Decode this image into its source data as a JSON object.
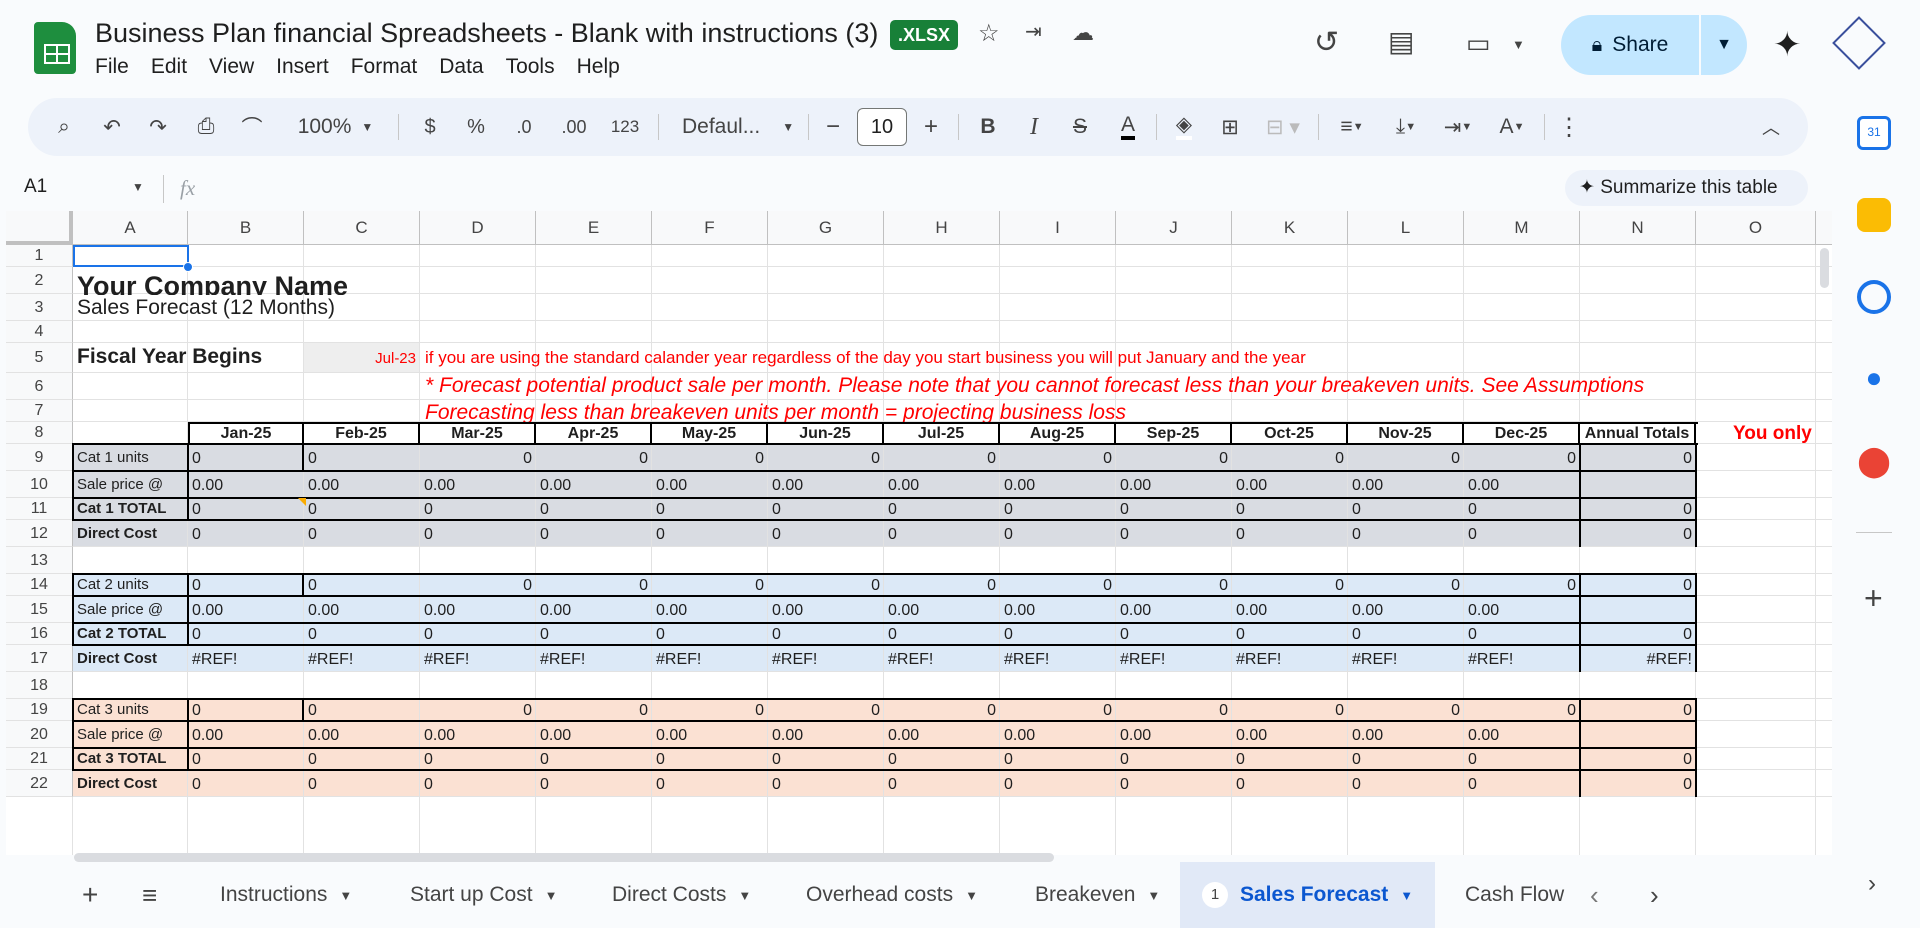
{
  "doc": {
    "title": "Business Plan financial Spreadsheets - Blank with instructions (3)",
    "badge": ".XLSX"
  },
  "menu": [
    "File",
    "Edit",
    "View",
    "Insert",
    "Format",
    "Data",
    "Tools",
    "Help"
  ],
  "share": {
    "label": "Share"
  },
  "toolbar": {
    "zoom": "100%",
    "currency": "$",
    "percent": "%",
    "dec_less": ".0",
    "dec_more": ".00",
    "format123": "123",
    "font": "Defaul...",
    "font_size": "10"
  },
  "formula": {
    "namebox": "A1",
    "fx": "fx",
    "summarize": "Summarize this table"
  },
  "columns": [
    "A",
    "B",
    "C",
    "D",
    "E",
    "F",
    "G",
    "H",
    "I",
    "J",
    "K",
    "L",
    "M",
    "N",
    "O"
  ],
  "rows": [
    "1",
    "2",
    "3",
    "4",
    "5",
    "6",
    "7",
    "8",
    "9",
    "10",
    "11",
    "12",
    "13",
    "14",
    "15",
    "16",
    "17",
    "18",
    "19",
    "20",
    "21",
    "22"
  ],
  "sheet": {
    "company": "Your Company Name",
    "subtitle": "Sales Forecast (12 Months)",
    "fiscal_label": "Fiscal Year Begins",
    "fiscal_value": "Jul-23",
    "note1": "if you are using the standard calander year regardless of the day you start business you will put January and the year",
    "note2": "* Forecast potential product sale per month.  Please note that you cannot forecast less than your breakeven units.  See Assumptions",
    "note3": "Forecasting less than breakeven units per month = projecting business loss",
    "you_only": "You only",
    "months": [
      "Jan-25",
      "Feb-25",
      "Mar-25",
      "Apr-25",
      "May-25",
      "Jun-25",
      "Jul-25",
      "Aug-25",
      "Sep-25",
      "Oct-25",
      "Nov-25",
      "Dec-25"
    ],
    "annual": "Annual Totals",
    "zero": "0",
    "price": "0.00",
    "ref": "#REF!",
    "cat1": {
      "units": "Cat 1 units",
      "price": "Sale price @",
      "total": "Cat 1 TOTAL",
      "direct": "Direct Cost"
    },
    "cat2": {
      "units": "Cat 2 units",
      "price": "Sale price @",
      "total": "Cat 2 TOTAL",
      "direct": "Direct Cost"
    },
    "cat3": {
      "units": "Cat 3 units",
      "price": "Sale price @",
      "total": "Cat 3 TOTAL",
      "direct": "Direct Cost"
    }
  },
  "tabs": [
    {
      "label": "Instructions"
    },
    {
      "label": "Start up Cost"
    },
    {
      "label": "Direct Costs"
    },
    {
      "label": "Overhead costs"
    },
    {
      "label": "Breakeven"
    },
    {
      "label": "Sales Forecast",
      "badge": "1",
      "active": true
    },
    {
      "label": "Cash Flow"
    }
  ],
  "colors": {
    "cat1": "#d9dce2",
    "cat2": "#dce9f7",
    "cat3": "#fbe1d3",
    "note": "#ff0000",
    "active_tab": "#0b57d0"
  }
}
